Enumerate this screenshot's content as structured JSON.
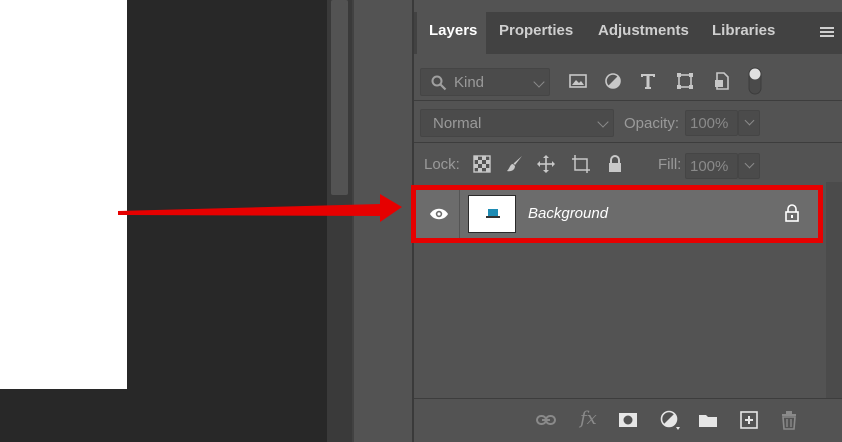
{
  "tabs": [
    {
      "label": "Layers",
      "active": true
    },
    {
      "label": "Properties",
      "active": false
    },
    {
      "label": "Adjustments",
      "active": false
    },
    {
      "label": "Libraries",
      "active": false
    }
  ],
  "filter": {
    "kind_label": "Kind",
    "icons": [
      "image-filter-icon",
      "adjustment-filter-icon",
      "type-filter-icon",
      "shape-filter-icon",
      "smart-object-filter-icon",
      "filter-toggle-icon"
    ]
  },
  "blend": {
    "mode": "Normal",
    "opacity_label": "Opacity:",
    "opacity_value": "100%"
  },
  "lock": {
    "label": "Lock:",
    "icons": [
      "lock-transparent-pixels-icon",
      "lock-image-pixels-icon",
      "lock-position-icon",
      "lock-artboard-icon",
      "lock-all-icon"
    ],
    "fill_label": "Fill:",
    "fill_value": "100%"
  },
  "layers": [
    {
      "name": "Background",
      "visible": true,
      "locked": true
    }
  ],
  "footer_icons": [
    "link-layers-icon",
    "fx-icon",
    "add-mask-icon",
    "new-adjustment-layer-icon",
    "new-group-icon",
    "new-layer-icon",
    "delete-layer-icon"
  ],
  "fx_label": "fx",
  "colors": {
    "panel_bg": "#535353",
    "tab_bar_bg": "#424242",
    "selected_layer_bg": "#6c6c6c",
    "highlight": "#e60000"
  }
}
